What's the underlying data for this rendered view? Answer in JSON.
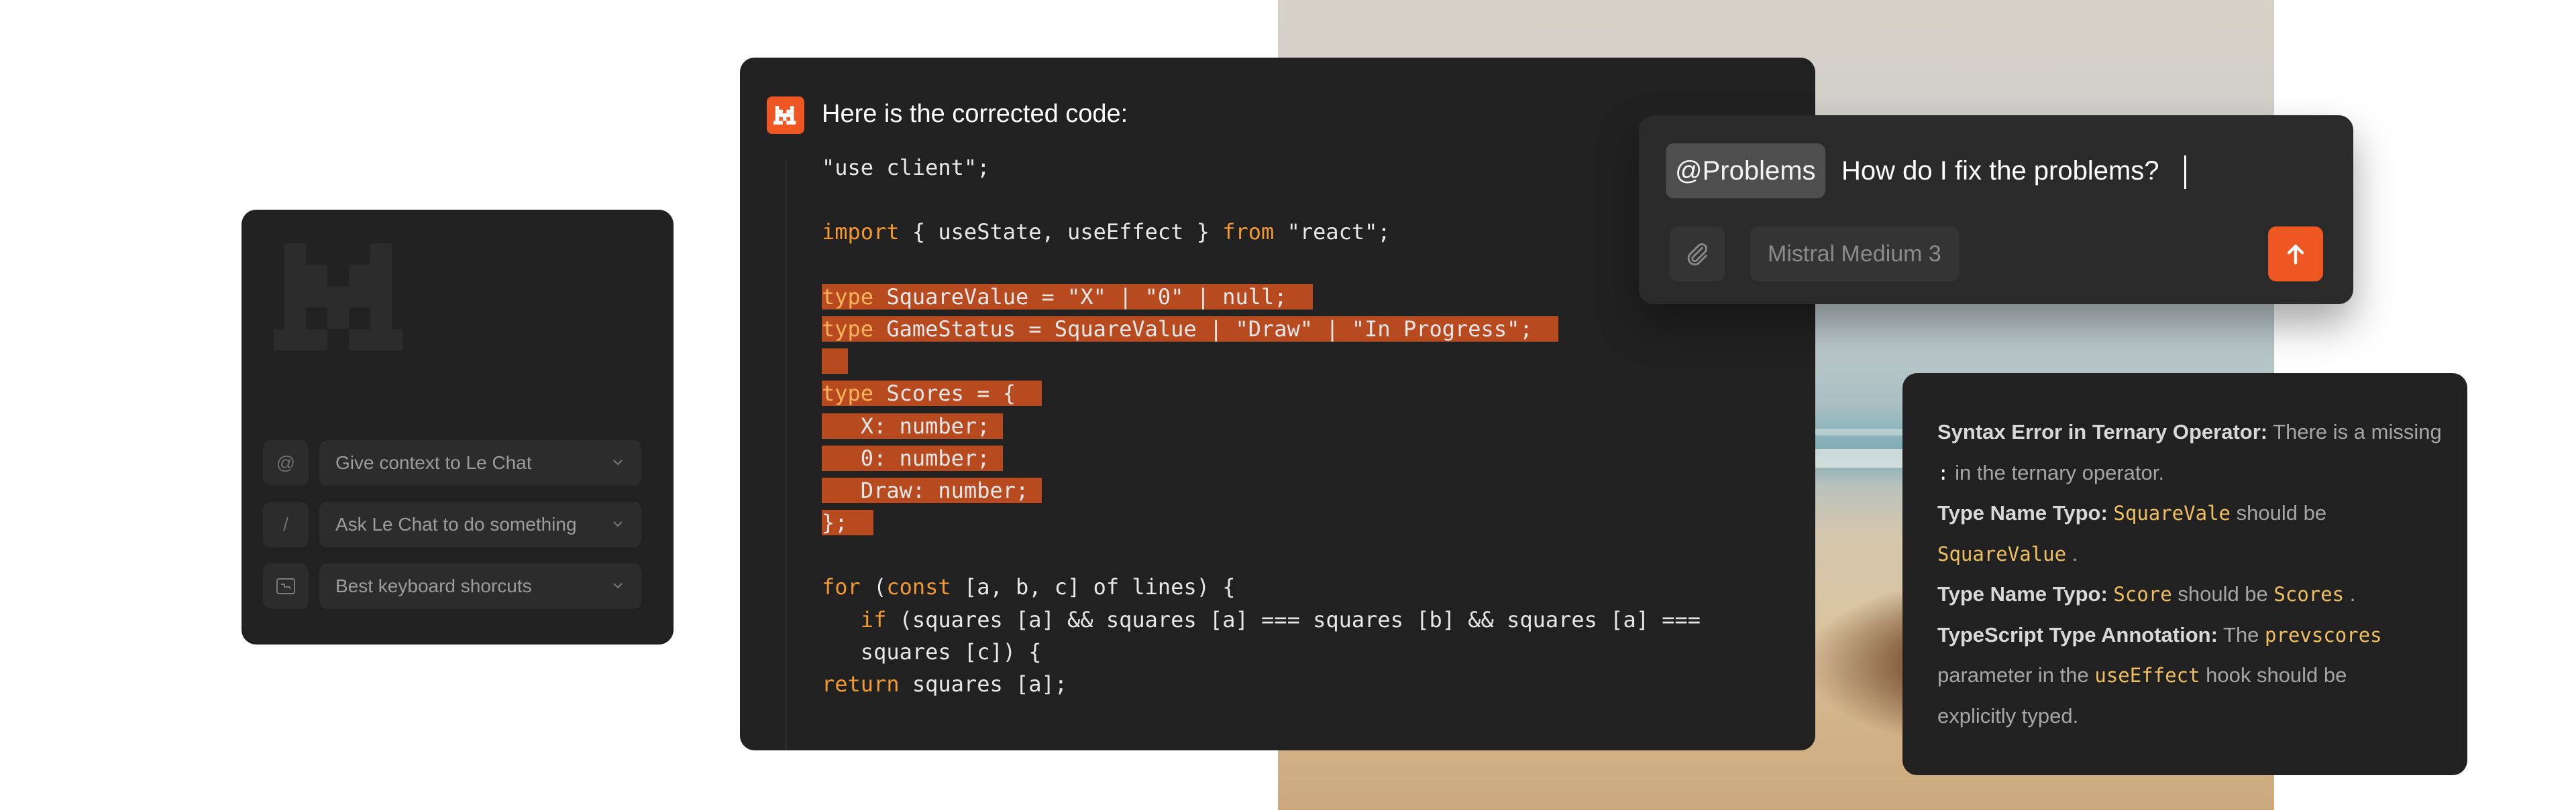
{
  "left_panel": {
    "shortcuts": [
      {
        "key": "@",
        "label": "Give context to Le Chat"
      },
      {
        "key": "/",
        "label": "Ask Le Chat to do something"
      },
      {
        "key_icon": "keyboard-icon",
        "label": "Best keyboard shorcuts"
      }
    ]
  },
  "code_panel": {
    "title": "Here is the corrected code:",
    "code": {
      "l1": "\"use client\";",
      "l2_kw": "import",
      "l2_a": " { useState, useEffect } ",
      "l2_kw2": "from",
      "l2_b": " \"react\";",
      "l3_kw": "type",
      "l3_rest": " SquareValue = \"X\" | \"0\" | null;",
      "l4_kw": "type",
      "l4_rest": " GameStatus = SquareValue | \"Draw\" | \"In Progress\";",
      "l5_kw": "type",
      "l5_rest": " Scores = {",
      "l6": "   X: number;",
      "l7": "   0: number;",
      "l8": "   Draw: number;",
      "l9": "};",
      "l10_kw": "for",
      "l10_a": " (",
      "l10_kw2": "const",
      "l10_b": " [a, b, c] of lines) {",
      "l11_kw": "if",
      "l11_rest": " (squares [a] && squares [a] === squares [b] && squares [a] ===",
      "l12": "   squares [c]) {",
      "l13_kw": "return",
      "l13_rest": " squares [a];"
    }
  },
  "prompt_panel": {
    "mention": "@Problems",
    "question": "How do I fix the problems?",
    "model": "Mistral Medium 3",
    "attach_icon": "paperclip-icon",
    "send_icon": "arrow-up-icon",
    "accent": "#ee5722"
  },
  "problems_panel": {
    "p1_title": "Syntax Error in Ternary Operator:",
    "p1_text_a": " There is a missing",
    "p1_code": ":",
    "p1_text_b": " in the ternary operator.",
    "p2_title": "Type Name Typo:",
    "p2_code_a": "SquareVale",
    "p2_text": " should be",
    "p2_code_b": "SquareValue",
    "p2_end": " .",
    "p3_title": "Type Name Typo:",
    "p3_code_a": "Score",
    "p3_text": " should be",
    "p3_code_b": "Scores",
    "p3_end": " .",
    "p4_title": "TypeScript Type Annotation:",
    "p4_text_a": " The",
    "p4_code_a": "prevscores",
    "p4_text_b": "parameter in the",
    "p4_code_b": "useEffect",
    "p4_text_c": "  hook should be",
    "p4_text_d": "explicitly typed."
  }
}
